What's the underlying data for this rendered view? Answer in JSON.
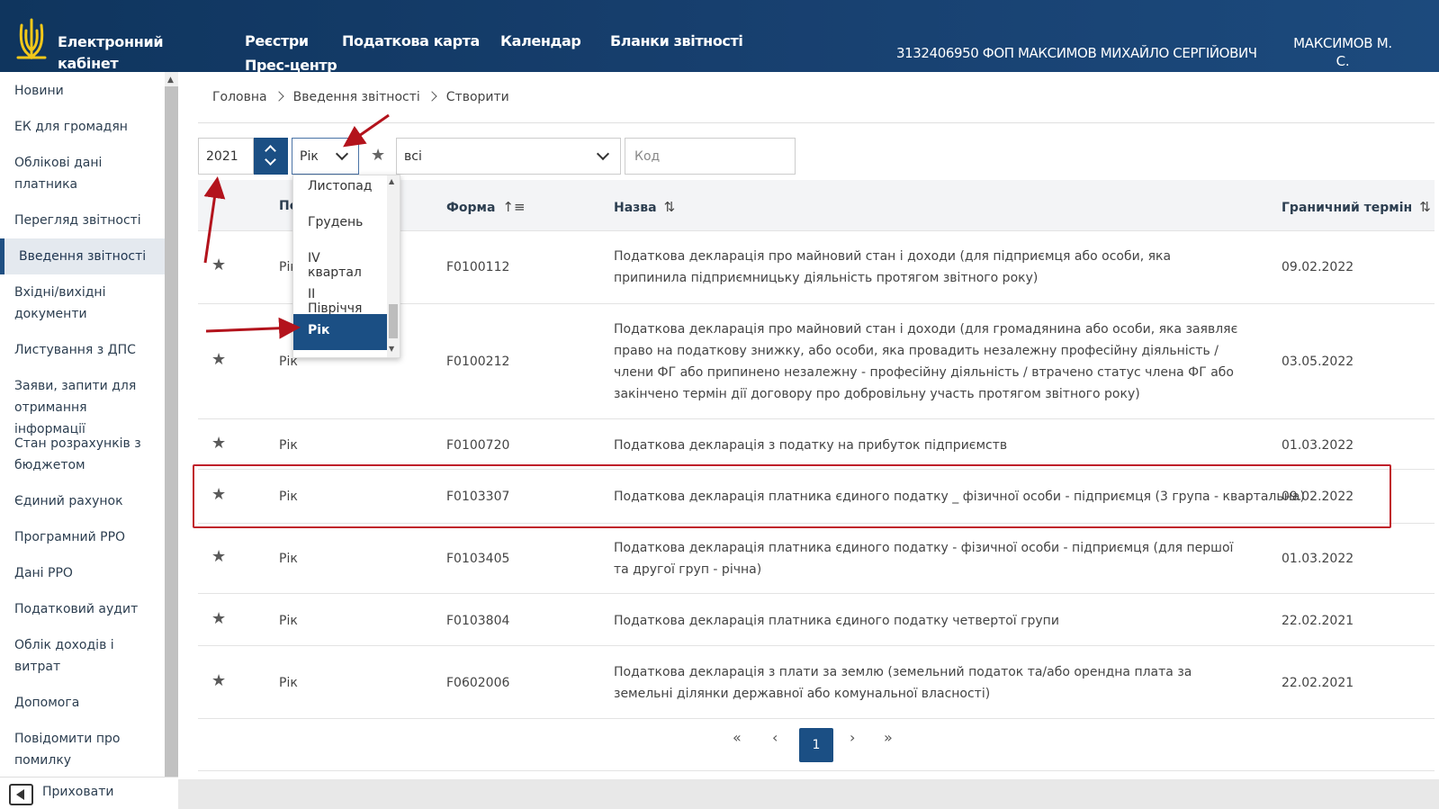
{
  "header": {
    "brand": "Електронний кабінет",
    "nav": [
      "Реєстри",
      "Податкова карта",
      "Календар",
      "Бланки звітності",
      "Прес-центр"
    ],
    "taxpayer": "3132406950 ФОП МАКСИМОВ МИХАЙЛО СЕРГІЙОВИЧ",
    "user": "МАКСИМОВ М. С."
  },
  "sidebar": {
    "items": [
      "Новини",
      "ЕК для громадян",
      "Облікові дані платника",
      "Перегляд звітності",
      "Введення звітності",
      "Вхідні/вихідні документи",
      "Листування з ДПС",
      "Заяви, запити для отримання інформації",
      "Стан розрахунків з бюджетом",
      "Єдиний рахунок",
      "Програмний РРО",
      "Дані РРО",
      "Податковий аудит",
      "Облік доходів і витрат",
      "Допомога",
      "Повідомити про помилку"
    ],
    "active": "Введення звітності",
    "hide_label": "Приховати"
  },
  "breadcrumb": [
    "Головна",
    "Введення звітності",
    "Створити"
  ],
  "filters": {
    "year": "2021",
    "period": "Рік",
    "type": "всі",
    "code_placeholder": "Код"
  },
  "period_dropdown": {
    "options": [
      "Листопад",
      "Грудень",
      "IV квартал",
      "II Півріччя",
      "Рік"
    ],
    "selected": "Рік"
  },
  "table": {
    "headers": {
      "period": "Пе",
      "form": "Форма",
      "name": "Назва",
      "deadline": "Граничний термін"
    },
    "rows": [
      {
        "period": "Рік",
        "form": "F0100112",
        "name": "Податкова декларація про майновий стан і доходи (для підприємця або особи, яка припинила підприємницьку діяльність протягом звітного року)",
        "deadline": "09.02.2022"
      },
      {
        "period": "Рік",
        "form": "F0100212",
        "name": "Податкова декларація про майновий стан і доходи (для громадянина або особи, яка заявляє право на податкову знижку, або особи, яка провадить незалежну професійну діяльність / члени ФГ або припинено незалежну - професійну діяльність / втрачено статус члена ФГ або закінчено термін дії договору про добровільну участь протягом звітного року)",
        "deadline": "03.05.2022"
      },
      {
        "period": "Рік",
        "form": "F0100720",
        "name": "Податкова декларація з податку на прибуток підприємств",
        "deadline": "01.03.2022"
      },
      {
        "period": "Рік",
        "form": "F0103307",
        "name": "Податкова декларація платника єдиного податку _ фізичної особи - підприємця (3 група - квартальна)",
        "deadline": "09.02.2022"
      },
      {
        "period": "Рік",
        "form": "F0103405",
        "name": "Податкова декларація платника єдиного податку - фізичної особи - підприємця (для першої та другої груп - річна)",
        "deadline": "01.03.2022"
      },
      {
        "period": "Рік",
        "form": "F0103804",
        "name": "Податкова декларація платника єдиного податку четвертої групи",
        "deadline": "22.02.2021"
      },
      {
        "period": "Рік",
        "form": "F0602006",
        "name": "Податкова декларація з плати за землю (земельний податок та/або орендна плата за земельні ділянки державної або комунальної власності)",
        "deadline": "22.02.2021"
      }
    ]
  },
  "pagination": {
    "first": "«",
    "prev": "‹",
    "current": "1",
    "next": "›",
    "last": "»"
  },
  "colors": {
    "header_bg": "#173f6e",
    "accent": "#1b4f84",
    "highlight_border": "#c0202a",
    "arrow": "#b3131c"
  }
}
